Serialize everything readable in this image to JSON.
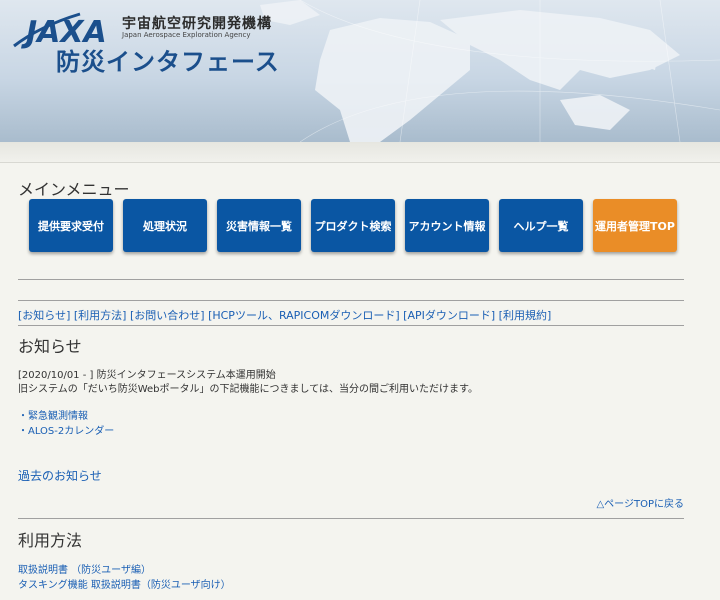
{
  "header": {
    "logo_text": "JAXA",
    "org_ja": "宇宙航空研究開発機構",
    "org_en": "Japan Aerospace Exploration Agency",
    "site_title": "防災インタフェース"
  },
  "main_menu": {
    "title": "メインメニュー",
    "buttons": [
      {
        "label": "提供要求受付"
      },
      {
        "label": "処理状況"
      },
      {
        "label": "災害情報一覧"
      },
      {
        "label": "プロダクト検索"
      },
      {
        "label": "アカウント情報"
      },
      {
        "label": "ヘルプ一覧"
      },
      {
        "label": "運用者管理TOP"
      }
    ]
  },
  "links": [
    {
      "label": "[お知らせ]"
    },
    {
      "label": "[利用方法]"
    },
    {
      "label": "[お問い合わせ]"
    },
    {
      "label": "[HCPツール、RAPICOMダウンロード]"
    },
    {
      "label": "[APIダウンロード]"
    },
    {
      "label": "[利用規約]"
    }
  ],
  "news": {
    "title": "お知らせ",
    "line1": "[2020/10/01 - ] 防災インタフェースシステム本運用開始",
    "line2": "旧システムの「だいち防災Webポータル」の下記機能につきましては、当分の間ご利用いただけます。",
    "items": [
      "・緊急観測情報",
      "・ALOS-2カレンダー"
    ],
    "past_link": "過去のお知らせ",
    "page_top": "△ページTOPに戻る"
  },
  "usage": {
    "title": "利用方法",
    "docs": [
      "取扱説明書 （防災ユーザ編）",
      "タスキング機能 取扱説明書（防災ユーザ向け）"
    ]
  },
  "colors": {
    "button_blue": "#0a56a3",
    "button_orange": "#ea8d27",
    "link": "#1a5fb4",
    "title_blue": "#1b4f8c"
  }
}
